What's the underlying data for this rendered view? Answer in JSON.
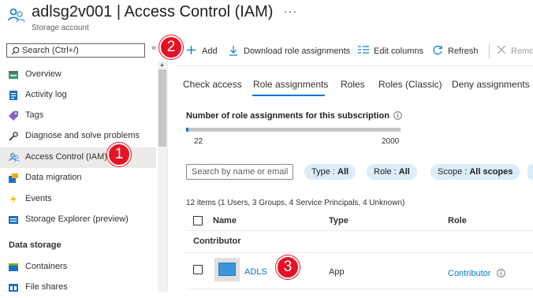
{
  "header": {
    "resource_name": "adlsg2v001",
    "separator": "|",
    "page_name": "Access Control (IAM)",
    "subtitle": "Storage account",
    "more": "···",
    "icon": "people-icon"
  },
  "nav": {
    "search_placeholder": "Search (Ctrl+/)",
    "collapse": "«",
    "items": [
      {
        "label": "Overview",
        "icon": "overview-icon"
      },
      {
        "label": "Activity log",
        "icon": "activity-log-icon"
      },
      {
        "label": "Tags",
        "icon": "tag-icon"
      },
      {
        "label": "Diagnose and solve problems",
        "icon": "wrench-icon"
      },
      {
        "label": "Access Control (IAM)",
        "icon": "people-icon",
        "active": true
      },
      {
        "label": "Data migration",
        "icon": "data-migration-icon"
      },
      {
        "label": "Events",
        "icon": "lightning-icon"
      },
      {
        "label": "Storage Explorer (preview)",
        "icon": "storage-explorer-icon"
      }
    ],
    "section_data_storage": "Data storage",
    "data_storage_items": [
      {
        "label": "Containers",
        "icon": "containers-icon"
      },
      {
        "label": "File shares",
        "icon": "file-shares-icon"
      }
    ]
  },
  "callouts": [
    "1",
    "2",
    "3"
  ],
  "commands": {
    "add": "Add",
    "download": "Download role assignments",
    "edit_columns": "Edit columns",
    "refresh": "Refresh",
    "remove": "Remo"
  },
  "tabs": [
    "Check access",
    "Role assignments",
    "Roles",
    "Roles (Classic)",
    "Deny assignments"
  ],
  "active_tab": "Role assignments",
  "assignment_count": {
    "title": "Number of role assignments for this subscription",
    "current": "22",
    "max": "2000",
    "fraction": 0.011
  },
  "filters": {
    "search_placeholder": "Search by name or email",
    "type": {
      "label": "Type : ",
      "value": "All"
    },
    "role": {
      "label": "Role : ",
      "value": "All"
    },
    "scope": {
      "label": "Scope : ",
      "value": "All scopes"
    }
  },
  "table": {
    "summary": "12 items (1 Users, 3 Groups, 4 Service Principals, 4 Unknown)",
    "columns": [
      "Name",
      "Type",
      "Role"
    ],
    "group": "Contributor",
    "rows": [
      {
        "name": "ADLS",
        "type": "App",
        "role": "Contributor",
        "icon": "app-icon"
      }
    ]
  },
  "colors": {
    "accent": "#0078d4",
    "callout": "#e81123",
    "pill_bg": "#dcecf9",
    "active_nav_bg": "#edebe9"
  }
}
